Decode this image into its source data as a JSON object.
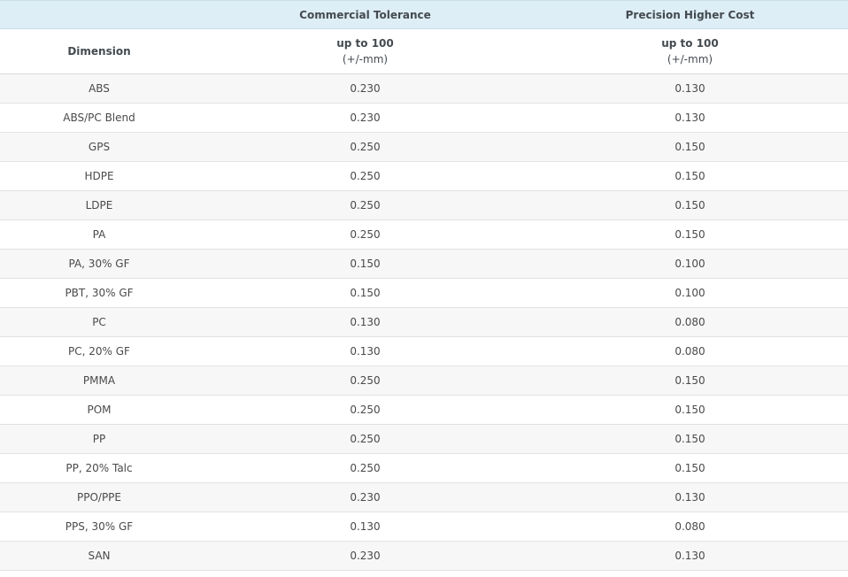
{
  "table": {
    "group_headers": [
      "",
      "Commercial Tolerance",
      "Precision Higher Cost"
    ],
    "column_headers": {
      "dimension": "Dimension",
      "commercial": {
        "line1": "up to 100",
        "line2": "(+/-mm)"
      },
      "precision": {
        "line1": "up to 100",
        "line2": "(+/-mm)"
      }
    },
    "rows": [
      {
        "material": "ABS",
        "commercial": "0.230",
        "precision": "0.130"
      },
      {
        "material": "ABS/PC Blend",
        "commercial": "0.230",
        "precision": "0.130"
      },
      {
        "material": "GPS",
        "commercial": "0.250",
        "precision": "0.150"
      },
      {
        "material": "HDPE",
        "commercial": "0.250",
        "precision": "0.150"
      },
      {
        "material": "LDPE",
        "commercial": "0.250",
        "precision": "0.150"
      },
      {
        "material": "PA",
        "commercial": "0.250",
        "precision": "0.150"
      },
      {
        "material": "PA, 30% GF",
        "commercial": "0.150",
        "precision": "0.100"
      },
      {
        "material": "PBT, 30% GF",
        "commercial": "0.150",
        "precision": "0.100"
      },
      {
        "material": "PC",
        "commercial": "0.130",
        "precision": "0.080"
      },
      {
        "material": "PC, 20% GF",
        "commercial": "0.130",
        "precision": "0.080"
      },
      {
        "material": "PMMA",
        "commercial": "0.250",
        "precision": "0.150"
      },
      {
        "material": "POM",
        "commercial": "0.250",
        "precision": "0.150"
      },
      {
        "material": "PP",
        "commercial": "0.250",
        "precision": "0.150"
      },
      {
        "material": "PP, 20% Talc",
        "commercial": "0.250",
        "precision": "0.150"
      },
      {
        "material": "PPO/PPE",
        "commercial": "0.230",
        "precision": "0.130"
      },
      {
        "material": "PPS, 30% GF",
        "commercial": "0.130",
        "precision": "0.080"
      },
      {
        "material": "SAN",
        "commercial": "0.230",
        "precision": "0.130"
      }
    ]
  }
}
